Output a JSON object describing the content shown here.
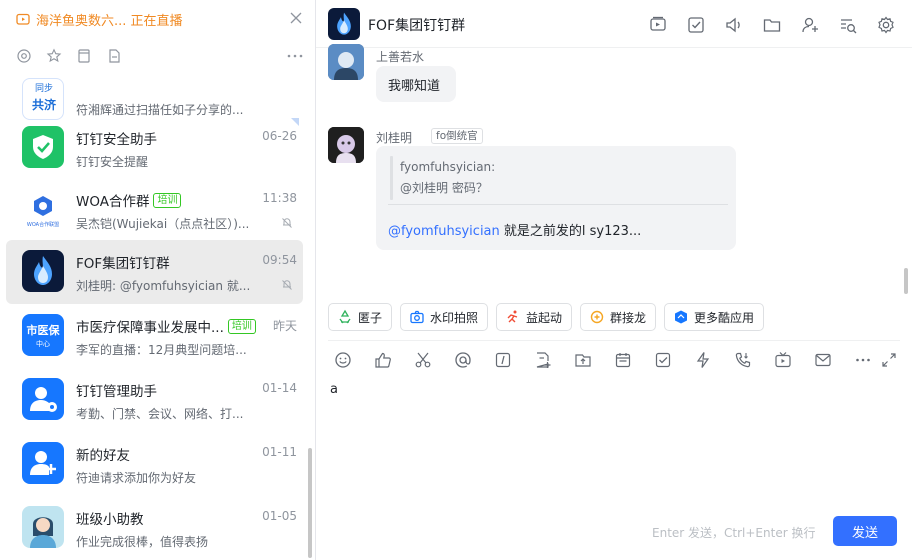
{
  "live_bar": {
    "text": "海洋鱼奥数六... 正在直播"
  },
  "conversations": [
    {
      "title": "",
      "tag": "",
      "time": "",
      "preview": "符湘辉通过扫描任如子分享的...",
      "avatar_text": "共济",
      "avatar_top_text": "同步"
    },
    {
      "title": "钉钉安全助手",
      "tag": "",
      "time": "06-26",
      "preview": "钉钉安全提醒"
    },
    {
      "title": "WOA合作群",
      "tag": "培训",
      "time": "11:38",
      "preview": "吴杰铠(Wujiekai（点点社区）)...",
      "avatar_text": "WOA合作联盟"
    },
    {
      "title": "FOF集团钉钉群",
      "tag": "",
      "time": "09:54",
      "preview": "刘桂明: @fyomfuhsyician 就..."
    },
    {
      "title": "市医疗保障事业发展中...",
      "tag": "培训",
      "time": "昨天",
      "preview": "李军的直播：12月典型问题培...",
      "avatar_text": "市医保",
      "avatar_sub": "中心"
    },
    {
      "title": "钉钉管理助手",
      "tag": "",
      "time": "01-14",
      "preview": "考勤、门禁、会议、网络、打..."
    },
    {
      "title": "新的好友",
      "tag": "",
      "time": "01-11",
      "preview": "符迪请求添加你为好友"
    },
    {
      "title": "班级小助教",
      "tag": "",
      "time": "01-05",
      "preview": "作业完成很棒，值得表扬"
    }
  ],
  "chat": {
    "title": "FOF集团钉钉群",
    "messages": [
      {
        "sender": "上善若水",
        "text": "我哪知道"
      },
      {
        "sender": "刘桂明",
        "badge": "fo倒统官",
        "quote_name": "fyomfuhsyician:",
        "quote_text": "@刘桂明 密码？",
        "mention": "@fyomfuhsyician",
        "text": " 就是之前发的l sy123..."
      }
    ]
  },
  "apps": [
    "匿子",
    "水印拍照",
    "益起动",
    "群接龙",
    "更多酷应用"
  ],
  "input": {
    "text": "a",
    "hint": "Enter 发送，Ctrl+Enter 换行",
    "send_label": "发送"
  },
  "colors": {
    "accent": "#3370ff",
    "live": "#f08a24",
    "tag": "#34c724"
  }
}
